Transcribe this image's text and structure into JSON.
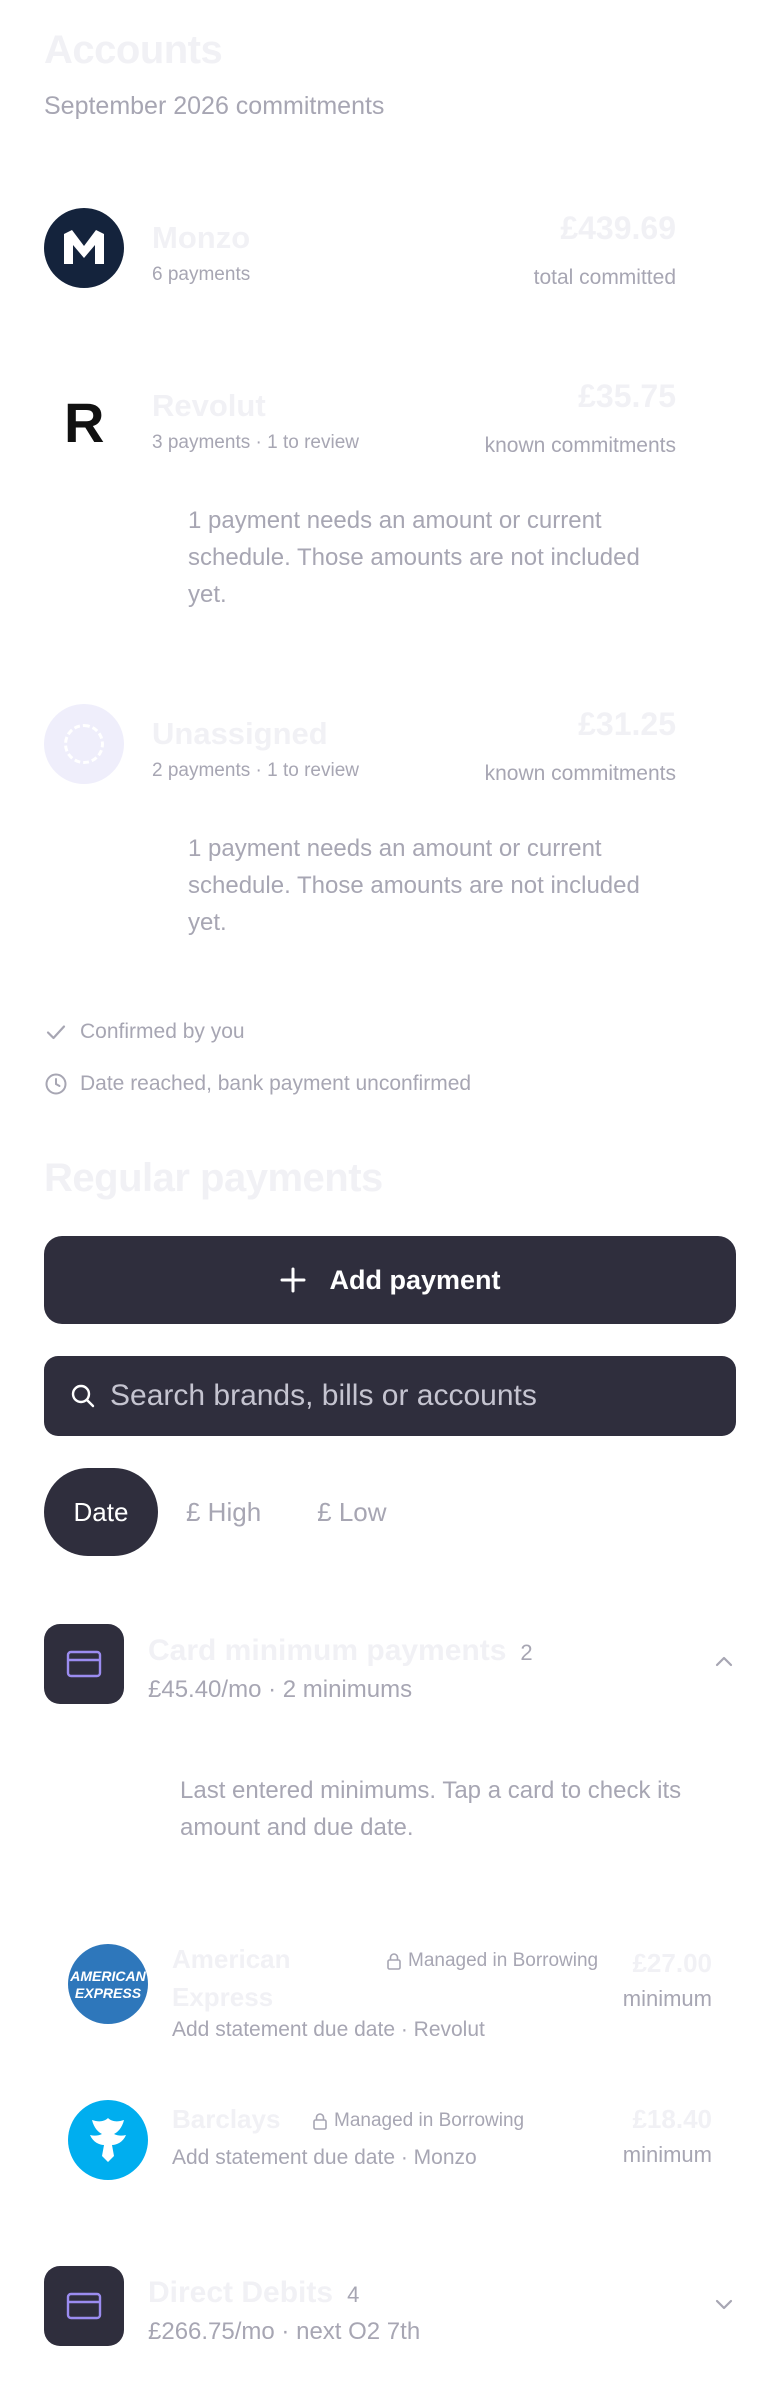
{
  "header": {
    "title": "Accounts",
    "subtitle": "September 2026 commitments"
  },
  "accounts": [
    {
      "name": "Monzo",
      "meta": "6 payments",
      "amount": "£439.69",
      "amount_label": "total committed",
      "logo_text": "M",
      "note": ""
    },
    {
      "name": "Revolut",
      "meta": "3 payments · 1 to review",
      "amount": "£35.75",
      "amount_label": "known commitments",
      "logo_text": "R",
      "note": "1 payment needs an amount or current schedule. Those amounts are not included yet."
    },
    {
      "name": "Unassigned",
      "meta": "2 payments · 1 to review",
      "amount": "£31.25",
      "amount_label": "known commitments",
      "logo_text": "",
      "note": "1 payment needs an amount or current schedule. Those amounts are not included yet."
    }
  ],
  "legend": {
    "confirmed": "Confirmed by you",
    "unconfirmed": "Date reached, bank payment unconfirmed"
  },
  "regular": {
    "title": "Regular payments",
    "add_button": "Add payment",
    "search_placeholder": "Search brands, bills or accounts",
    "sort_chips": [
      "Date",
      "£ High",
      "£ Low"
    ],
    "active_sort": "Date"
  },
  "groups": [
    {
      "title": "Card minimum payments",
      "count": "2",
      "subtitle": "£45.40/mo · 2 minimums",
      "expanded": true,
      "note": "Last entered minimums. Tap a card to check its amount and due date.",
      "items": [
        {
          "name_line1": "American",
          "name_line2": "Express",
          "managed": "Managed in Borrowing",
          "sub": "Add statement due date  ·  Revolut",
          "amount": "£27.00",
          "amount_label": "minimum",
          "logo_text_top": "AMERICAN",
          "logo_text_bottom": "EXPRESS"
        },
        {
          "name_line1": "Barclays",
          "name_line2": "",
          "managed": "Managed in Borrowing",
          "sub": "Add statement due date  ·  Monzo",
          "amount": "£18.40",
          "amount_label": "minimum"
        }
      ]
    },
    {
      "title": "Direct Debits",
      "count": "4",
      "subtitle": "£266.75/mo · next O2 7th",
      "expanded": false
    }
  ],
  "colors": {
    "dark": "#2f2e3d",
    "muted_text": "#a7a6b3",
    "faint_text": "#f1f1f5",
    "monzo_navy": "#14233c",
    "amex_blue": "#2e77bb",
    "barclays_blue": "#00aeef",
    "unassigned_lilac": "#efeefb"
  },
  "icons": {
    "add": "plus-icon",
    "search": "search-icon",
    "card_group": "credit-card-icon",
    "confirmed": "check-icon",
    "unconfirmed": "clock-icon",
    "managed": "lock-icon",
    "expand": "chevron-up-icon",
    "collapse": "chevron-down-icon"
  }
}
